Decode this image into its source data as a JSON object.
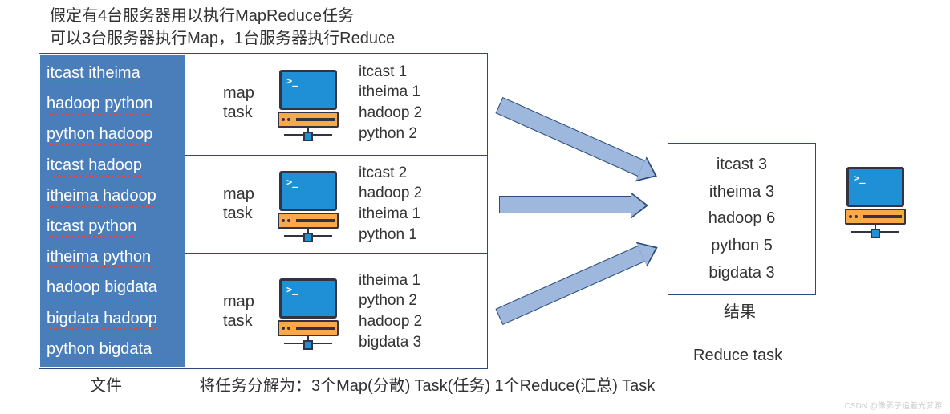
{
  "header": {
    "line1": "假定有4台服务器用以执行MapReduce任务",
    "line2": "可以3台服务器执行Map，1台服务器执行Reduce"
  },
  "file": {
    "label": "文件",
    "lines": [
      "itcast itheima",
      "hadoop python",
      "python hadoop",
      "itcast hadoop",
      "itheima hadoop",
      "itcast python",
      "itheima python",
      "hadoop bigdata",
      "bigdata hadoop",
      "python bigdata"
    ]
  },
  "map_label": {
    "line1": "map",
    "line2": "task"
  },
  "map_outputs": [
    [
      "itcast 1",
      "itheima 1",
      "hadoop 2",
      "python 2"
    ],
    [
      "itcast 2",
      "hadoop 2",
      "itheima 1",
      "python 1"
    ],
    [
      "itheima 1",
      "python 2",
      "hadoop 2",
      "bigdata 3"
    ]
  ],
  "result": {
    "label": "结果",
    "lines": [
      "itcast 3",
      "itheima 3",
      "hadoop 6",
      "python 5",
      "bigdata 3"
    ]
  },
  "reduce_label": "Reduce task",
  "bottom_note": "将任务分解为：3个Map(分散) Task(任务) 1个Reduce(汇总) Task",
  "prompt": ">_",
  "watermark": "CSDN @像影子追着光梦游"
}
